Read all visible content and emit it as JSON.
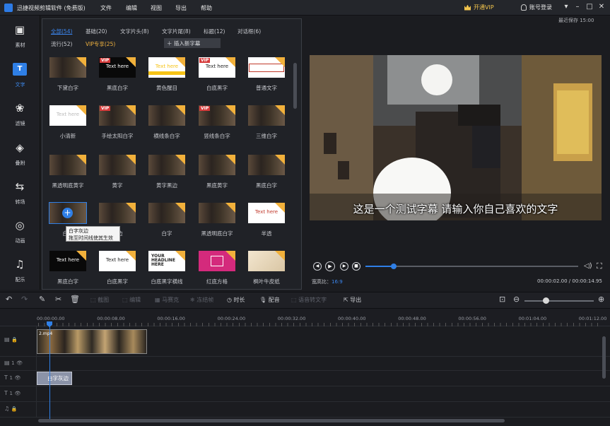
{
  "app": {
    "title": "迅捷视频剪辑软件 (免费版)",
    "menu": [
      "文件",
      "编辑",
      "视图",
      "导出",
      "帮助"
    ],
    "vip_label": "开通VIP",
    "login_label": "账号登录",
    "last_saved": "最近保存 15:00"
  },
  "sidebar": {
    "items": [
      {
        "label": "素材",
        "icon": "media-icon"
      },
      {
        "label": "文字",
        "icon": "text-icon"
      },
      {
        "label": "滤镜",
        "icon": "filter-icon"
      },
      {
        "label": "叠附",
        "icon": "overlay-icon"
      },
      {
        "label": "转场",
        "icon": "transition-icon"
      },
      {
        "label": "动画",
        "icon": "animation-icon"
      },
      {
        "label": "配乐",
        "icon": "music-icon"
      }
    ],
    "active_index": 1
  },
  "library": {
    "categories": [
      "全部(54)",
      "基础(20)",
      "文字片头(8)",
      "文字片尾(8)",
      "标题(12)",
      "对话框(6)",
      "流行(52)",
      "VIP专享(25)"
    ],
    "insert_label": "插入新字幕",
    "items": [
      {
        "label": "下黛白字",
        "style": "video",
        "vip": false,
        "text": ""
      },
      {
        "label": "黑底白字",
        "style": "black",
        "vip": true,
        "text": "Text here"
      },
      {
        "label": "黄色醒目",
        "style": "white-yellow",
        "vip": false,
        "text": "Text here"
      },
      {
        "label": "白底黑字",
        "style": "white",
        "vip": true,
        "text": "Text here"
      },
      {
        "label": "普通文字",
        "style": "outline",
        "vip": false,
        "text": ""
      },
      {
        "label": "小清新",
        "style": "white-light",
        "vip": false,
        "text": "Text here"
      },
      {
        "label": "手绘太阳白字",
        "style": "video",
        "vip": true,
        "text": ""
      },
      {
        "label": "横线条白字",
        "style": "video",
        "vip": false,
        "text": ""
      },
      {
        "label": "竖线条白字",
        "style": "video",
        "vip": true,
        "text": ""
      },
      {
        "label": "三维白字",
        "style": "video",
        "vip": false,
        "text": ""
      },
      {
        "label": "黑透明底黄字",
        "style": "video",
        "vip": false,
        "text": ""
      },
      {
        "label": "黄字",
        "style": "video",
        "vip": false,
        "text": ""
      },
      {
        "label": "黄字黑边",
        "style": "video",
        "vip": false,
        "text": ""
      },
      {
        "label": "黑底黄字",
        "style": "video",
        "vip": false,
        "text": ""
      },
      {
        "label": "黑底白字",
        "style": "video",
        "vip": false,
        "text": ""
      },
      {
        "label": "白字",
        "style": "selected",
        "vip": false,
        "text": ""
      },
      {
        "label": "黑边",
        "style": "video",
        "vip": false,
        "text": ""
      },
      {
        "label": "白字",
        "style": "video",
        "vip": false,
        "text": ""
      },
      {
        "label": "黑透明底白字",
        "style": "video",
        "vip": false,
        "text": ""
      },
      {
        "label": "半透",
        "style": "white-red",
        "vip": false,
        "text": "Text here"
      },
      {
        "label": "黑底白字",
        "style": "black",
        "vip": false,
        "text": "Text here"
      },
      {
        "label": "白底黑字",
        "style": "white",
        "vip": false,
        "text": "Text here"
      },
      {
        "label": "白底黑字横线",
        "style": "headline",
        "vip": false,
        "text": "YOUR HEADLINE HERE"
      },
      {
        "label": "红底方格",
        "style": "pink",
        "vip": false,
        "text": ""
      },
      {
        "label": "枫叶牛皮纸",
        "style": "paper",
        "vip": false,
        "text": ""
      }
    ],
    "tooltip": [
      "白字灰边",
      "拖至时间线使其生效"
    ]
  },
  "preview": {
    "subtitle": "这是一个测试字幕 请输入你自己喜欢的文字",
    "progress": 0.133,
    "aspect_label": "宽高比：",
    "aspect_value": "16:9",
    "time": "00:00:02.00 / 00:00:14.95"
  },
  "toolbar": {
    "items": [
      {
        "label": "截图",
        "enabled": false
      },
      {
        "label": "编辑",
        "enabled": false
      },
      {
        "label": "马赛克",
        "enabled": false
      },
      {
        "label": "冻结帧",
        "enabled": false
      },
      {
        "label": "时长",
        "enabled": true
      },
      {
        "label": "配音",
        "enabled": true
      },
      {
        "label": "语音转文字",
        "enabled": false
      },
      {
        "label": "导出",
        "enabled": true
      }
    ]
  },
  "timeline": {
    "ticks": [
      "00:00:00.00",
      "00:00:08.00",
      "00:00:16.00",
      "00:00:24.00",
      "00:00:32.00",
      "00:00:40.00",
      "00:00:48.00",
      "00:00:56.00",
      "00:01:04.00",
      "00:01:12.00"
    ],
    "video_clip_label": "2.mp4",
    "text_clip_label": "白字灰边",
    "track_numbers": [
      "1",
      "1",
      "1"
    ]
  }
}
